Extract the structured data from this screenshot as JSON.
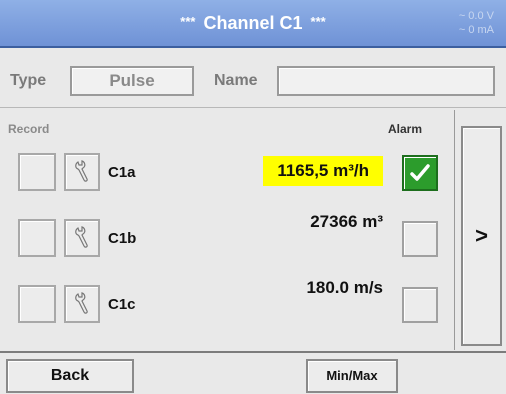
{
  "header": {
    "stars_left": "***",
    "title": "Channel C1",
    "stars_right": "***",
    "voltage": "~ 0.0 V",
    "current": "~ 0 mA"
  },
  "type": {
    "label": "Type",
    "value": "Pulse"
  },
  "name": {
    "label": "Name",
    "value": ""
  },
  "table": {
    "record_header": "Record",
    "alarm_header": "Alarm",
    "rows": [
      {
        "name": "C1a",
        "value": "1165,5 m³/h",
        "alarm_checked": true,
        "highlighted": true
      },
      {
        "name": "C1b",
        "value": "27366 m³",
        "alarm_checked": false,
        "highlighted": false
      },
      {
        "name": "C1c",
        "value": "180.0 m/s",
        "alarm_checked": false,
        "highlighted": false
      }
    ]
  },
  "nav": {
    "next_label": ">"
  },
  "footer": {
    "back_label": "Back",
    "minmax_label": "Min/Max"
  },
  "colors": {
    "title_bar": "#7f9fe0",
    "highlight": "#ffff00",
    "alarm_on": "#2c9c2c"
  },
  "icons": {
    "settings": "wrench-icon",
    "alarm": "checkmark-icon"
  }
}
